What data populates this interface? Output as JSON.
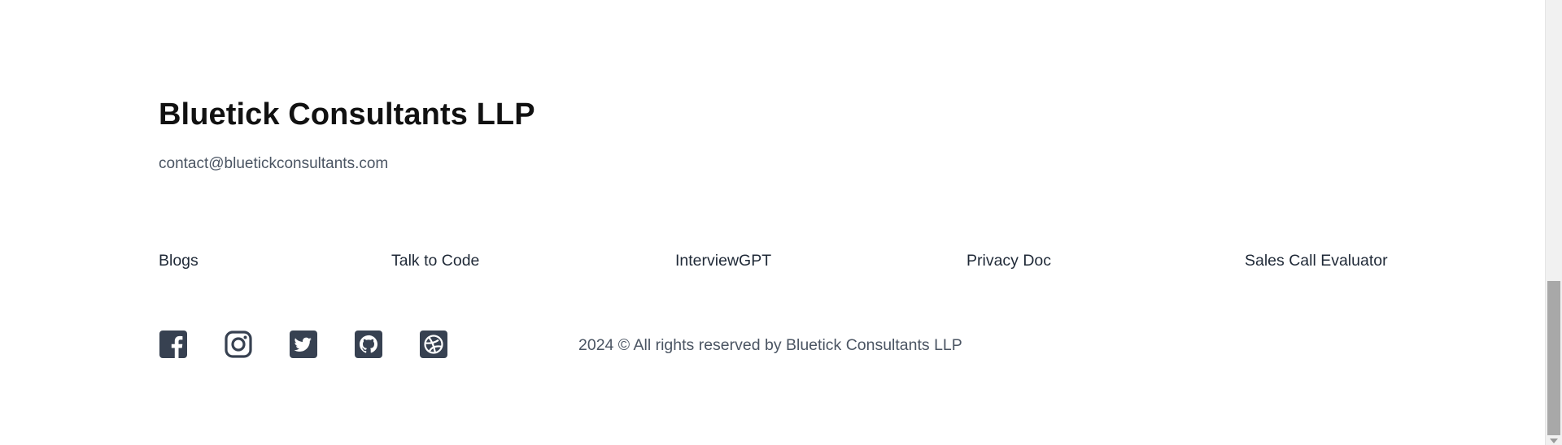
{
  "footer": {
    "company_name": "Bluetick Consultants LLP",
    "contact_email": "contact@bluetickconsultants.com",
    "nav_links": [
      "Blogs",
      "Talk to Code",
      "InterviewGPT",
      "Privacy Doc",
      "Sales Call Evaluator"
    ],
    "social_icons": [
      "facebook-icon",
      "instagram-icon",
      "twitter-icon",
      "github-icon",
      "dribbble-icon"
    ],
    "copyright": "2024 © All rights reserved by Bluetick Consultants LLP"
  },
  "colors": {
    "heading": "#111111",
    "body_text": "#4b5563",
    "link_text": "#1f2937",
    "icon": "#374151"
  }
}
